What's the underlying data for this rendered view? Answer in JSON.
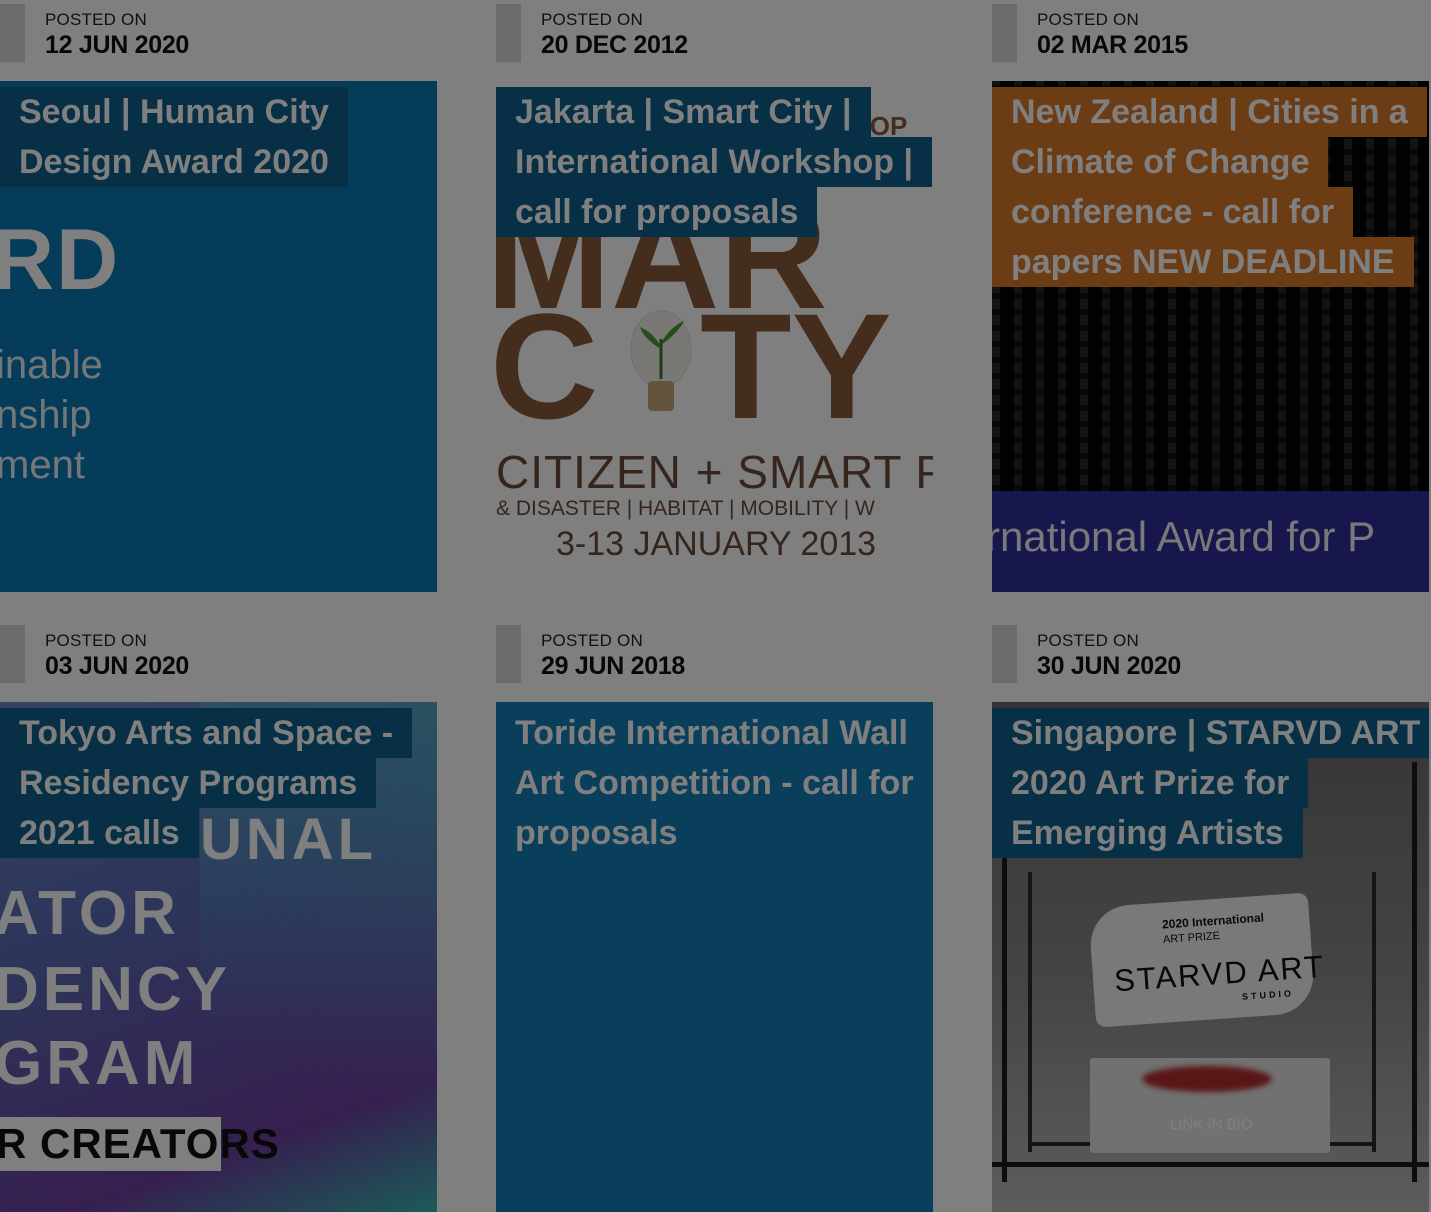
{
  "posts": [
    {
      "posted_label": "POSTED ON",
      "date": "12 JUN 2020",
      "title": "Seoul | Human City Design Award 2020",
      "art": [
        "RD",
        "inable",
        "nship",
        "ment"
      ]
    },
    {
      "posted_label": "POSTED ON",
      "date": "20 DEC 2012",
      "title": "Jakarta | Smart City | International Workshop | call for proposals",
      "art": [
        "HOP",
        "MAR",
        "C",
        "TY",
        "CITIZEN + SMART PI",
        "& DISASTER  |  HABITAT  |  MOBILITY  |  W",
        "3-13 JANUARY 2013"
      ]
    },
    {
      "posted_label": "POSTED ON",
      "date": "02 MAR 2015",
      "title": "New Zealand | Cities in a Climate of Change conference - call for papers NEW DEADLINE",
      "art": [
        "rnational Award for P"
      ]
    },
    {
      "posted_label": "POSTED ON",
      "date": "03 JUN 2020",
      "title": "Tokyo Arts and Space - Residency Programs 2021 calls",
      "art": [
        "UNAL",
        "ATOR",
        "DENCY",
        "GRAM",
        "R CREATORS"
      ]
    },
    {
      "posted_label": "POSTED ON",
      "date": "29 JUN 2018",
      "title": "Toride International Wall Art Competition - call for proposals",
      "art": []
    },
    {
      "posted_label": "POSTED ON",
      "date": "30 JUN 2020",
      "title": "Singapore | STARVD ART 2020 Art Prize for Emerging Artists",
      "art": [
        "2020 International",
        "ART PRIZE",
        "STARVD ART",
        "STUDIO",
        "LINK IN BIO"
      ]
    }
  ],
  "colors": {
    "title_blue": "#0e5e8a",
    "title_orange": "#d9782b",
    "overlay": "rgba(0,0,0,0.5)"
  }
}
